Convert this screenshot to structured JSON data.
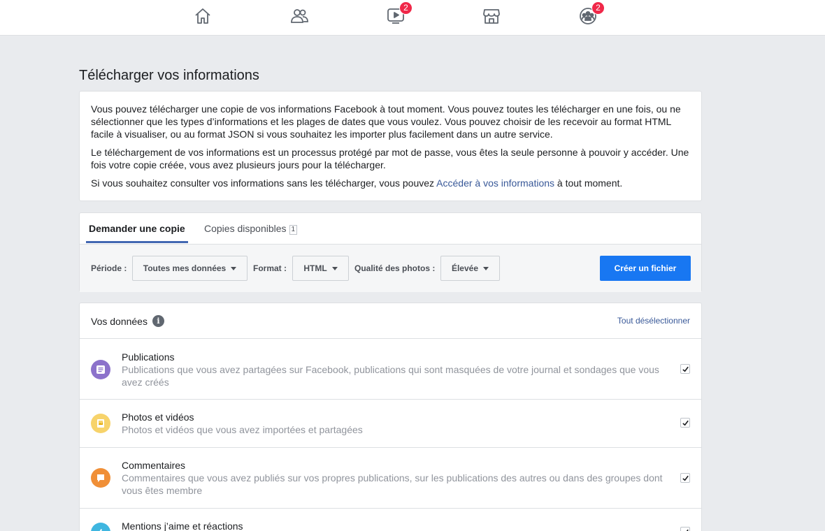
{
  "nav": {
    "icons": [
      {
        "name": "home-icon"
      },
      {
        "name": "friends-icon"
      },
      {
        "name": "watch-icon",
        "badge": "2"
      },
      {
        "name": "marketplace-icon"
      },
      {
        "name": "groups-icon",
        "badge": "2"
      }
    ],
    "badge_color": "#f02849"
  },
  "page": {
    "title": "Télécharger vos informations"
  },
  "intro": {
    "p1": "Vous pouvez télécharger une copie de vos informations Facebook à tout moment. Vous pouvez toutes les télécharger en une fois, ou ne sélectionner que les types d’informations et les plages de dates que vous voulez. Vous pouvez choisir de les recevoir au format HTML facile à visualiser, ou au format JSON si vous souhaitez les importer plus facilement dans un autre service.",
    "p2": "Le téléchargement de vos informations est un processus protégé par mot de passe, vous êtes la seule personne à pouvoir y accéder. Une fois votre copie créée, vous avez plusieurs jours pour la télécharger.",
    "p3_before": "Si vous souhaitez consulter vos informations sans les télécharger, vous pouvez ",
    "p3_link": "Accéder à vos informations",
    "p3_after": " à tout moment."
  },
  "tabs": {
    "request": "Demander une copie",
    "available": "Copies disponibles",
    "available_count": "1"
  },
  "filters": {
    "period_label": "Période :",
    "period_value": "Toutes mes données",
    "format_label": "Format :",
    "format_value": "HTML",
    "quality_label": "Qualité des photos :",
    "quality_value": "Élevée",
    "create_button": "Créer un fichier",
    "accent": "#1877f2"
  },
  "data": {
    "title": "Vos données",
    "deselect_all": "Tout désélectionner",
    "items": [
      {
        "title": "Publications",
        "description": "Publications que vous avez partagées sur Facebook, publications qui sont masquées de votre journal et sondages que vous avez créés",
        "icon": "posts-icon",
        "color": "#8c72cb",
        "checked": true
      },
      {
        "title": "Photos et vidéos",
        "description": "Photos et vidéos que vous avez importées et partagées",
        "icon": "photos-icon",
        "color": "#f7d36b",
        "checked": true
      },
      {
        "title": "Commentaires",
        "description": "Commentaires que vous avez publiés sur vos propres publications, sur les publications des autres ou dans des groupes dont vous êtes membre",
        "icon": "comment-icon",
        "color": "#f08f37",
        "checked": true
      },
      {
        "title": "Mentions j’aime et réactions",
        "description": "",
        "icon": "like-icon",
        "color": "#3fb6e0",
        "checked": true
      }
    ]
  }
}
